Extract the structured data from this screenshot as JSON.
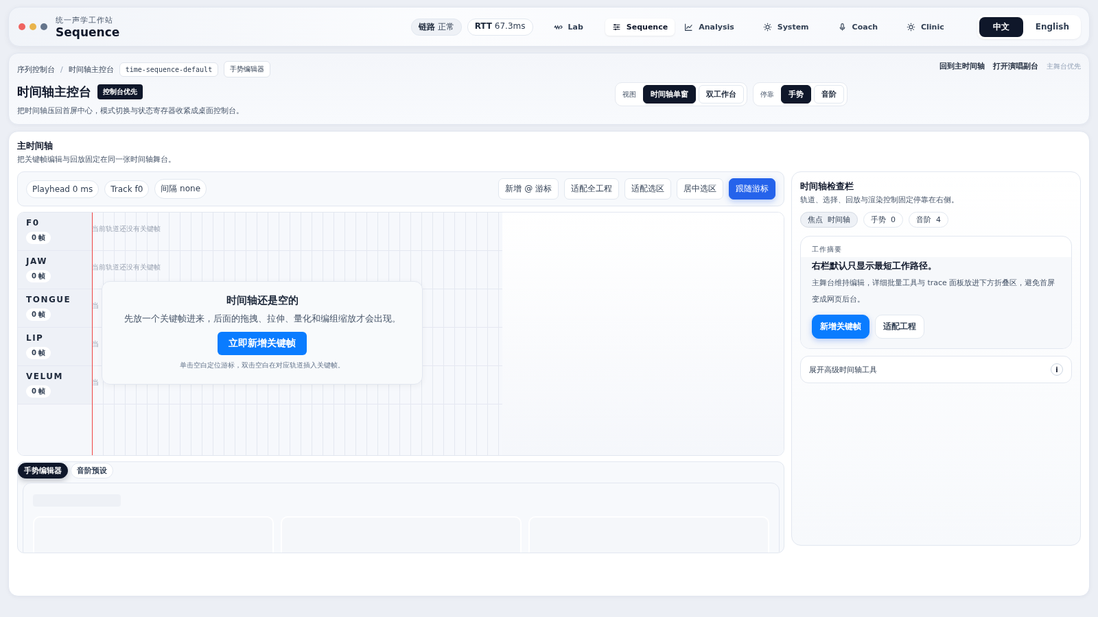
{
  "window": {
    "subtitle": "统一声学工作站",
    "title": "Sequence",
    "controls": [
      {
        "color": "#ef6461"
      },
      {
        "color": "#e9b44c"
      },
      {
        "color": "#64748b"
      }
    ]
  },
  "status": [
    {
      "label": "链路",
      "value": "正常",
      "selected": true
    },
    {
      "label": "RTT",
      "value": "67.3ms",
      "selected": false
    }
  ],
  "nav": [
    {
      "label": "Lab",
      "selected": false
    },
    {
      "label": "Sequence",
      "selected": true
    },
    {
      "label": "Analysis",
      "selected": false
    },
    {
      "label": "System",
      "selected": false
    },
    {
      "label": "Coach",
      "selected": false
    },
    {
      "label": "Clinic",
      "selected": false
    }
  ],
  "languages": [
    {
      "label": "中文",
      "selected": true
    },
    {
      "label": "English",
      "selected": false
    }
  ],
  "breadcrumb": {
    "items": [
      "序列控制台",
      "时间轴主控台"
    ],
    "separator": "/",
    "tags": [
      "time-sequence-default",
      "手势编辑器"
    ]
  },
  "header": {
    "title": "时间轴主控台",
    "badge": "控制台优先",
    "description": "把时间轴压回首屏中心，模式切换与状态寄存器收紧成桌面控制台。",
    "links": [
      "回到主时间轴",
      "打开演唱副台"
    ],
    "note": "主舞台优先"
  },
  "segments": [
    {
      "label": "视图",
      "options": [
        {
          "label": "时间轴单窗",
          "selected": true
        },
        {
          "label": "双工作台",
          "selected": false
        }
      ]
    },
    {
      "label": "停靠",
      "options": [
        {
          "label": "手势",
          "selected": true
        },
        {
          "label": "音阶",
          "selected": false
        }
      ]
    }
  ],
  "main": {
    "title": "主时间轴",
    "description": "把关键帧编辑与回放固定在同一张时间轴舞台。"
  },
  "timeline": {
    "chips": [
      "Playhead 0 ms",
      "Track f0",
      "间隔 none"
    ],
    "actions": [
      {
        "label": "新增 @ 游标",
        "kind": "default"
      },
      {
        "label": "适配全工程",
        "kind": "default"
      },
      {
        "label": "适配选区",
        "kind": "default"
      },
      {
        "label": "居中选区",
        "kind": "default"
      },
      {
        "label": "跟随游标",
        "kind": "primary"
      }
    ],
    "tracks": [
      {
        "name": "F0",
        "count": "0 帧",
        "placeholder": "当前轨道还没有关键帧"
      },
      {
        "name": "JAW",
        "count": "0 帧",
        "placeholder": "当前轨道还没有关键帧"
      },
      {
        "name": "TONGUE",
        "count": "0 帧",
        "placeholder": "当"
      },
      {
        "name": "LIP",
        "count": "0 帧",
        "placeholder": "当"
      },
      {
        "name": "VELUM",
        "count": "0 帧",
        "placeholder": "当"
      }
    ],
    "empty_state": {
      "title": "时间轴还是空的",
      "description": "先放一个关键帧进来，后面的拖拽、拉伸、量化和编组缩放才会出现。",
      "button": "立即新增关键帧",
      "hint": "单击空白定位游标，双击空白在对应轨道插入关键帧。"
    }
  },
  "bottom_tabs": [
    {
      "label": "手势编辑器",
      "selected": true
    },
    {
      "label": "音阶预设",
      "selected": false
    }
  ],
  "inspector": {
    "title": "时间轴检查栏",
    "description": "轨道、选择、回放与渲染控制固定停靠在右侧。",
    "chips": [
      {
        "label": "焦点",
        "value": "时间轴",
        "selected": true
      },
      {
        "label": "手势",
        "value": "0",
        "selected": false
      },
      {
        "label": "音阶",
        "value": "4",
        "selected": false
      }
    ],
    "summary": {
      "label": "工作摘要",
      "title": "右栏默认只显示最短工作路径。",
      "text": "主舞台维持编辑，详细批量工具与 trace 面板放进下方折叠区，避免首屏变成网页后台。",
      "actions": [
        {
          "label": "新增关键帧",
          "kind": "primary"
        },
        {
          "label": "适配工程",
          "kind": "default"
        }
      ]
    },
    "advanced": {
      "label": "展开高级时间轴工具",
      "icon": "i"
    }
  }
}
